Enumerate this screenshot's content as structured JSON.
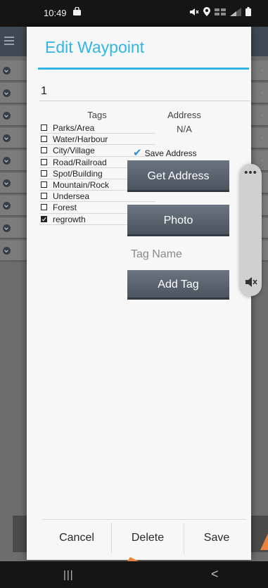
{
  "status_bar": {
    "time": "10:49"
  },
  "dialog": {
    "title": "Edit Waypoint",
    "name_value": "1",
    "tags_header": "Tags",
    "tags": [
      {
        "label": "Parks/Area",
        "checked": false
      },
      {
        "label": "Water/Harbour",
        "checked": false
      },
      {
        "label": "City/Village",
        "checked": false
      },
      {
        "label": "Road/Railroad",
        "checked": false
      },
      {
        "label": "Spot/Building",
        "checked": false
      },
      {
        "label": "Mountain/Rock",
        "checked": false
      },
      {
        "label": "Undersea",
        "checked": false
      },
      {
        "label": "Forest",
        "checked": false
      },
      {
        "label": "regrowth",
        "checked": true
      }
    ],
    "address_header": "Address",
    "address_value": "N/A",
    "save_address_label": "Save Address",
    "save_address_checked": true,
    "get_address_label": "Get Address",
    "photo_label": "Photo",
    "tag_name_placeholder": "Tag Name",
    "add_tag_label": "Add Tag",
    "cancel_label": "Cancel",
    "delete_label": "Delete",
    "save_label": "Save"
  },
  "colors": {
    "accent": "#33b5e5",
    "button": "#56616b",
    "checkmark": "#2f8fd8"
  }
}
